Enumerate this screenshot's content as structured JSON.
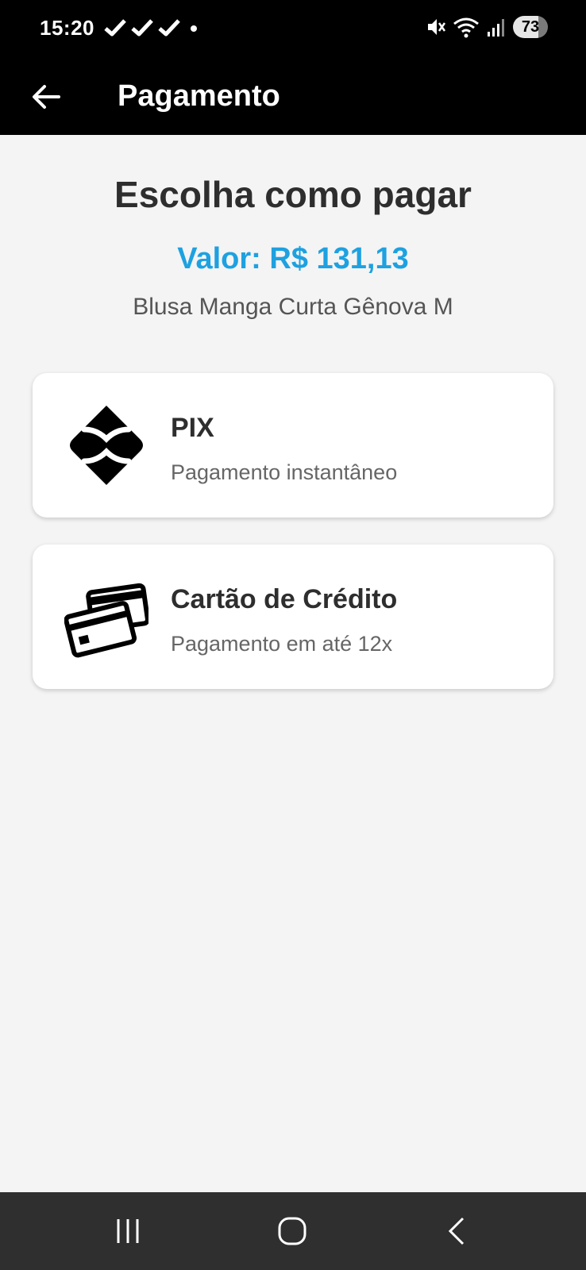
{
  "status_bar": {
    "time": "15:20",
    "battery": "73",
    "icons": [
      "check-icon",
      "check-icon",
      "check-icon",
      "dot-icon",
      "mute-icon",
      "wifi-icon",
      "signal-icon"
    ]
  },
  "app_bar": {
    "title": "Pagamento",
    "back_icon": "arrow-left-icon"
  },
  "content": {
    "heading": "Escolha como pagar",
    "amount": "Valor: R$ 131,13",
    "product": "Blusa Manga Curta Gênova M"
  },
  "options": [
    {
      "title": "PIX",
      "subtitle": "Pagamento instantâneo",
      "icon": "pix-icon"
    },
    {
      "title": "Cartão de Crédito",
      "subtitle": "Pagamento em até 12x",
      "icon": "credit-card-icon"
    }
  ],
  "nav_bar": {
    "icons": [
      "recents-icon",
      "home-icon",
      "back-icon"
    ]
  },
  "colors": {
    "accent": "#1ea1e0",
    "app_bar": "#000000",
    "background": "#f4f4f4",
    "nav_bar": "#2f2f2f"
  }
}
